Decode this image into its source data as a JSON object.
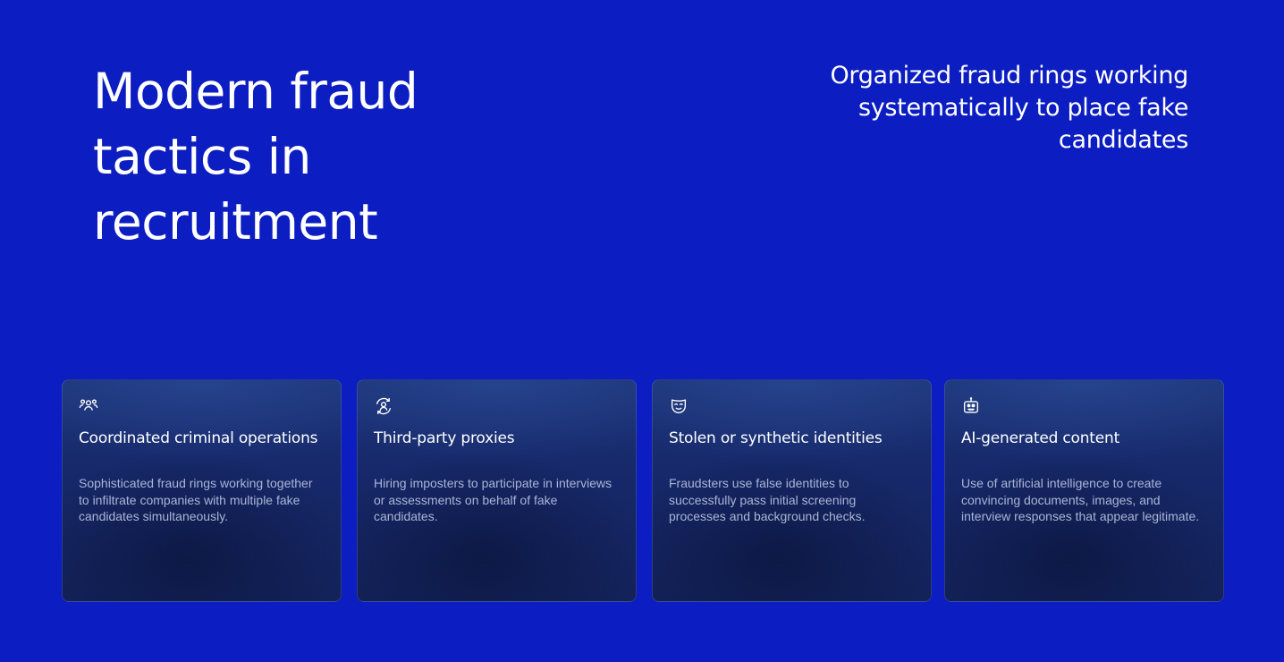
{
  "hero": {
    "headline": "Modern fraud tactics in recruitment",
    "subheadline": "Organized fraud rings working systematically to place fake candidates"
  },
  "cards": [
    {
      "icon": "group-users-icon",
      "title": "Coordinated criminal operations",
      "description": "Sophisticated fraud rings working together to infiltrate companies with multiple fake candidates simultaneously."
    },
    {
      "icon": "user-swap-icon",
      "title": "Third-party proxies",
      "description": "Hiring imposters to participate in interviews or assessments on behalf of fake candidates."
    },
    {
      "icon": "mask-icon",
      "title": "Stolen or synthetic identities",
      "description": "Fraudsters use false identities to successfully pass initial screening processes and background checks."
    },
    {
      "icon": "robot-icon",
      "title": "AI-generated content",
      "description": "Use of artificial intelligence to create convincing documents, images, and interview responses that appear legitimate."
    }
  ],
  "colors": {
    "background": "#0c1dc2",
    "card": "#17296b",
    "text": "#ffffff",
    "muted_text": "#a9b6d6"
  }
}
